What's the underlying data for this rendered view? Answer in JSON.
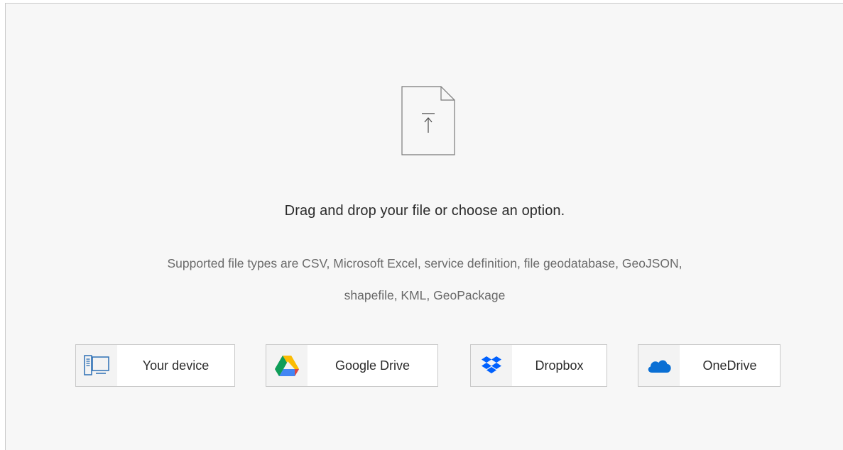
{
  "dropzone": {
    "headline": "Drag and drop your file or choose an option.",
    "supported_line1": "Supported file types are CSV, Microsoft Excel, service definition, file geodatabase, GeoJSON,",
    "supported_line2": "shapefile, KML, GeoPackage"
  },
  "options": [
    {
      "label": "Your device",
      "icon": "computer-icon"
    },
    {
      "label": "Google Drive",
      "icon": "google-drive-icon"
    },
    {
      "label": "Dropbox",
      "icon": "dropbox-icon"
    },
    {
      "label": "OneDrive",
      "icon": "onedrive-icon"
    }
  ],
  "colors": {
    "background": "#f7f7f7",
    "device_icon": "#2d6fb5",
    "dropbox": "#0061fe",
    "onedrive": "#0a6fd4"
  }
}
